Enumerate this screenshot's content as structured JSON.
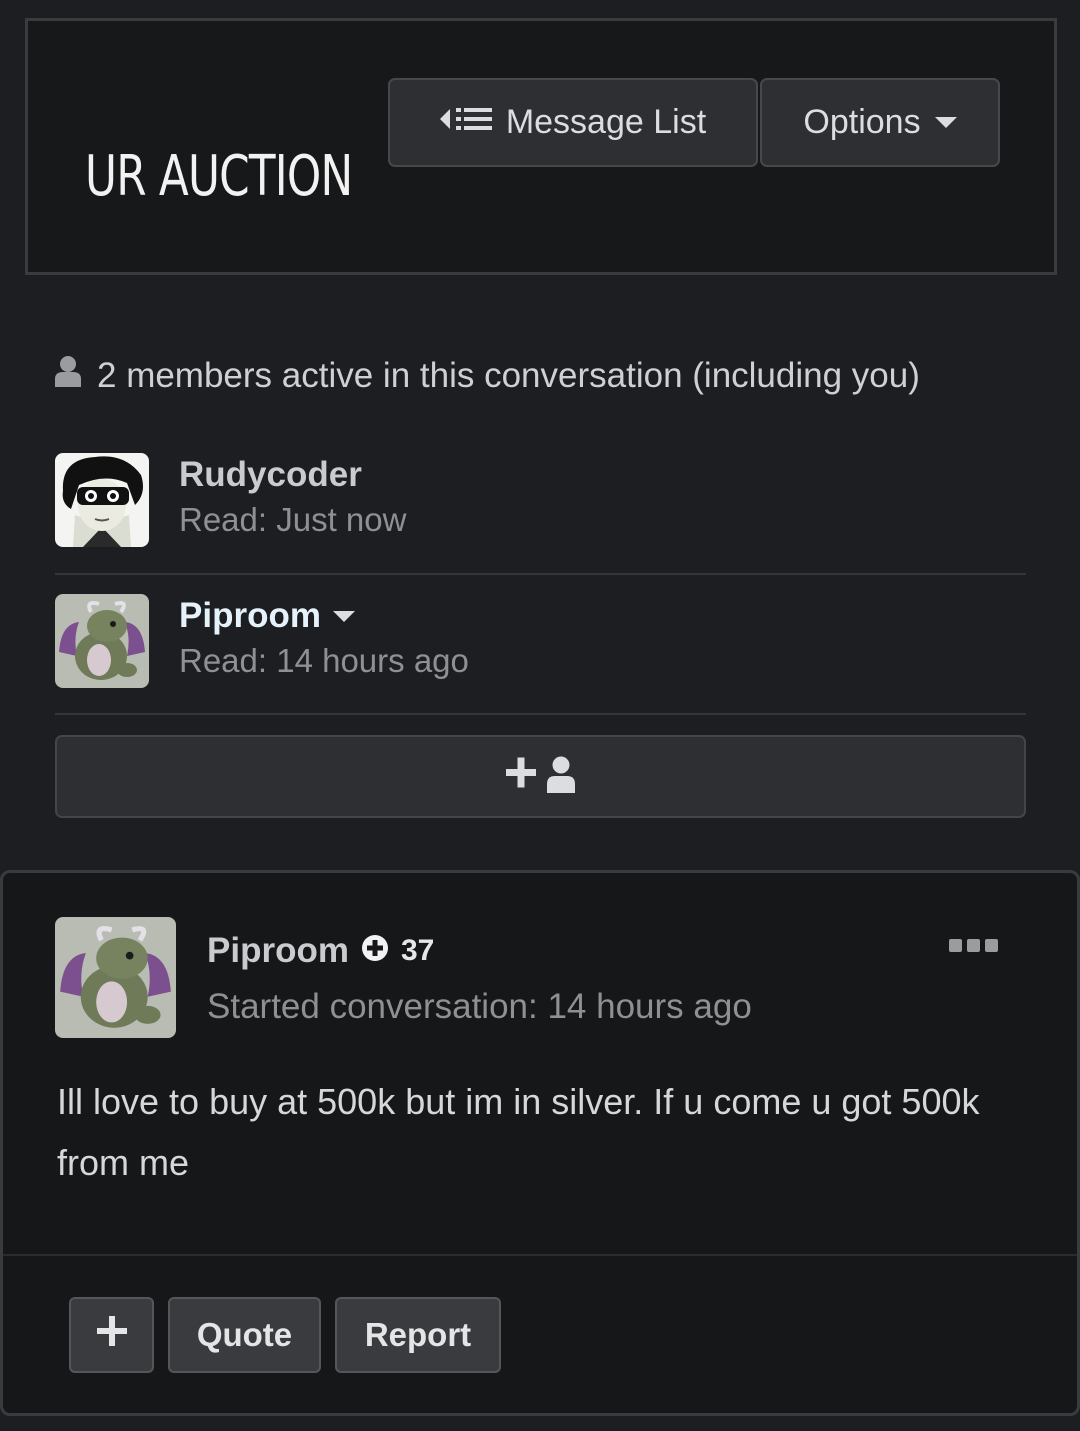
{
  "header": {
    "title": "UR AUCTION",
    "message_list_label": "Message List",
    "options_label": "Options"
  },
  "participants": {
    "active_text": "2 members active in this conversation (including you)",
    "members": [
      {
        "name": "Rudycoder",
        "read": "Read: Just now"
      },
      {
        "name": "Piproom",
        "read": "Read: 14 hours ago"
      }
    ]
  },
  "post": {
    "author": "Piproom",
    "reputation": "37",
    "meta": "Started conversation: 14 hours ago",
    "body": "Ill love to buy at 500k but im in silver. If u come u got 500k from me",
    "actions": {
      "quote_label": "Quote",
      "report_label": "Report"
    }
  },
  "colors": {
    "background": "#1d1e22",
    "panel": "#17181a",
    "button": "#2e2f33",
    "text_muted": "#8e9094",
    "highlight_name": "#e6f2fb"
  },
  "icons": {
    "message_list": "list-back-icon",
    "options": "caret-down-icon",
    "active_members": "user-icon",
    "add_member": "add-user-icon",
    "reputation": "plus-circle-icon",
    "post_menu": "ellipsis-icon",
    "add_action": "plus-icon"
  }
}
